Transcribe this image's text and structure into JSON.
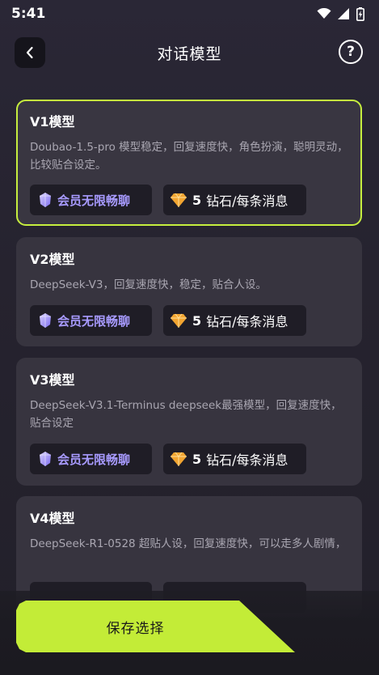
{
  "status": {
    "time": "5:41"
  },
  "header": {
    "title": "对话模型",
    "help_label": "?"
  },
  "models": [
    {
      "title": "V1模型",
      "desc": "Doubao-1.5-pro 模型稳定，回复速度快，角色扮演，聪明灵动，比较贴合设定。",
      "vip_label": "会员无限畅聊",
      "cost_num": "5",
      "cost_text": "钻石/每条消息",
      "selected": true
    },
    {
      "title": "V2模型",
      "desc": "DeepSeek-V3，回复速度快，稳定，贴合人设。",
      "vip_label": "会员无限畅聊",
      "cost_num": "5",
      "cost_text": "钻石/每条消息"
    },
    {
      "title": "V3模型",
      "desc": "DeepSeek-V3.1-Terminus deepseek最强模型，回复速度快，贴合设定",
      "vip_label": "会员无限畅聊",
      "cost_num": "5",
      "cost_text": "钻石/每条消息"
    },
    {
      "title": "V4模型",
      "desc": "DeepSeek-R1-0528 超贴人设，回复速度快，可以走多人剧情，"
    }
  ],
  "footer": {
    "save_label": "保存选择"
  },
  "colors": {
    "accent": "#c3ec37",
    "vip": "#a89bff",
    "card": "#37343f"
  },
  "icons": {
    "vip": "crystal-icon",
    "cost": "diamond-icon"
  }
}
